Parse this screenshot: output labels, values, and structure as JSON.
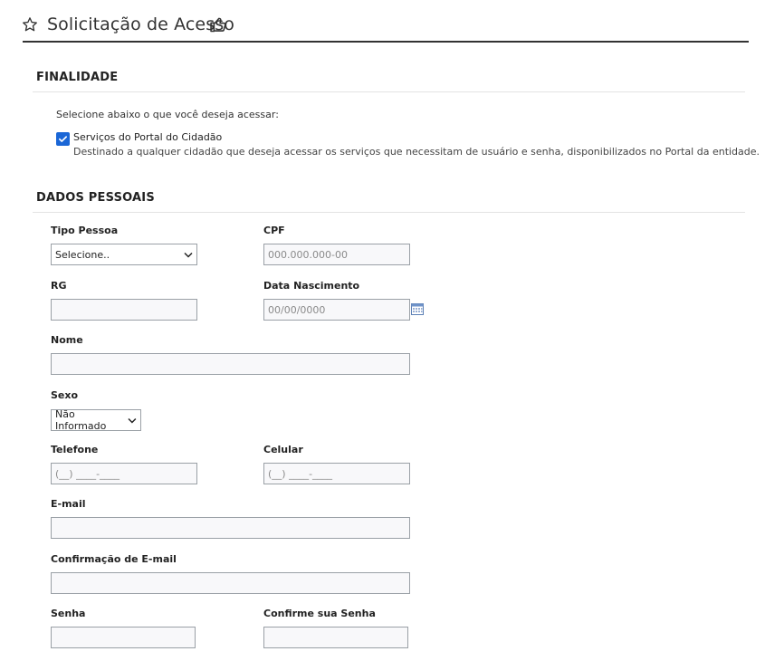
{
  "header": {
    "title": "Solicitação de Acesso",
    "favorite_icon": "star-outline-icon",
    "like_icon": "thumbs-up-icon"
  },
  "finalidade": {
    "section_title": "FINALIDADE",
    "instruction": "Selecione abaixo o que você deseja acessar:",
    "option_label": "Serviços do Portal do Cidadão",
    "option_checked": true,
    "option_description": "Destinado a qualquer cidadão que deseja acessar os serviços que necessitam de usuário e senha, disponibilizados no Portal da entidade."
  },
  "dados": {
    "section_title": "DADOS PESSOAIS",
    "tipo_pessoa": {
      "label": "Tipo Pessoa",
      "value": "Selecione.."
    },
    "cpf": {
      "label": "CPF",
      "placeholder": "000.000.000-00"
    },
    "rg": {
      "label": "RG",
      "value": ""
    },
    "data_nascimento": {
      "label": "Data Nascimento",
      "placeholder": "00/00/0000",
      "icon": "calendar-icon"
    },
    "nome": {
      "label": "Nome",
      "value": ""
    },
    "sexo": {
      "label": "Sexo",
      "value": "Não Informado"
    },
    "telefone": {
      "label": "Telefone",
      "placeholder": "(__) ____-____"
    },
    "celular": {
      "label": "Celular",
      "placeholder": "(__) ____-____"
    },
    "email": {
      "label": "E-mail",
      "value": ""
    },
    "email_confirm": {
      "label": "Confirmação de E-mail",
      "value": ""
    },
    "senha": {
      "label": "Senha",
      "value": ""
    },
    "senha_confirm": {
      "label": "Confirme sua Senha",
      "value": ""
    }
  },
  "colors": {
    "accent": "#1a66d6",
    "rule": "#333333",
    "field_border": "#9aa0a6",
    "field_bg": "#f8f8fa"
  }
}
